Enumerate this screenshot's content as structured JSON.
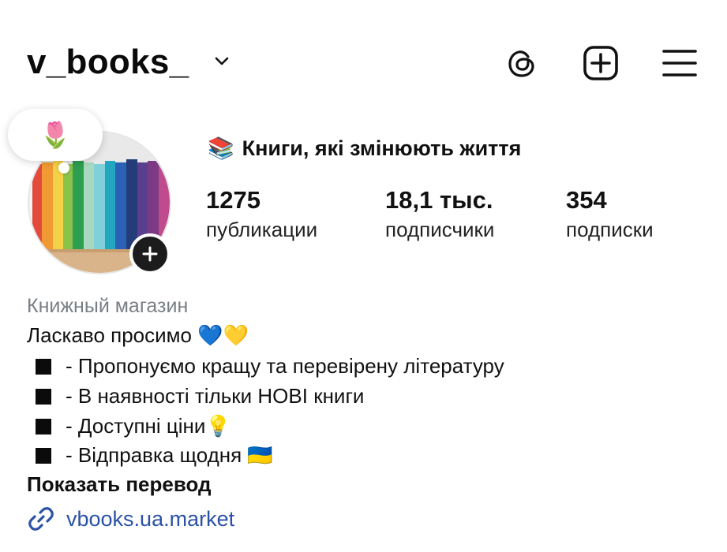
{
  "header": {
    "username": "v_books_",
    "icons": [
      "chevron-down-icon",
      "threads-icon",
      "add-post-icon",
      "menu-icon"
    ]
  },
  "avatar": {
    "note_emoji": "🌷"
  },
  "profile": {
    "display_emoji": "📚",
    "display_name": "Книги, які змінюють життя"
  },
  "stats": [
    {
      "number": "1275",
      "label": "публикации"
    },
    {
      "number": "18,1 тыс.",
      "label": "подписчики"
    },
    {
      "number": "354",
      "label": "подписки"
    }
  ],
  "bio": {
    "category": "Книжный магазин",
    "greeting": "Ласкаво просимо 💙💛",
    "bullets": [
      "- Пропонуємо кращу та перевірену літературу",
      "- В наявності тільки НОВІ книги",
      "- Доступні ціни💡",
      "- Відправка щодня 🇺🇦"
    ],
    "show_translation": "Показать перевод",
    "link": "vbooks.ua.market"
  },
  "colors": {
    "link": "#2b52a6",
    "category": "#7a7f85",
    "text": "#111111"
  }
}
